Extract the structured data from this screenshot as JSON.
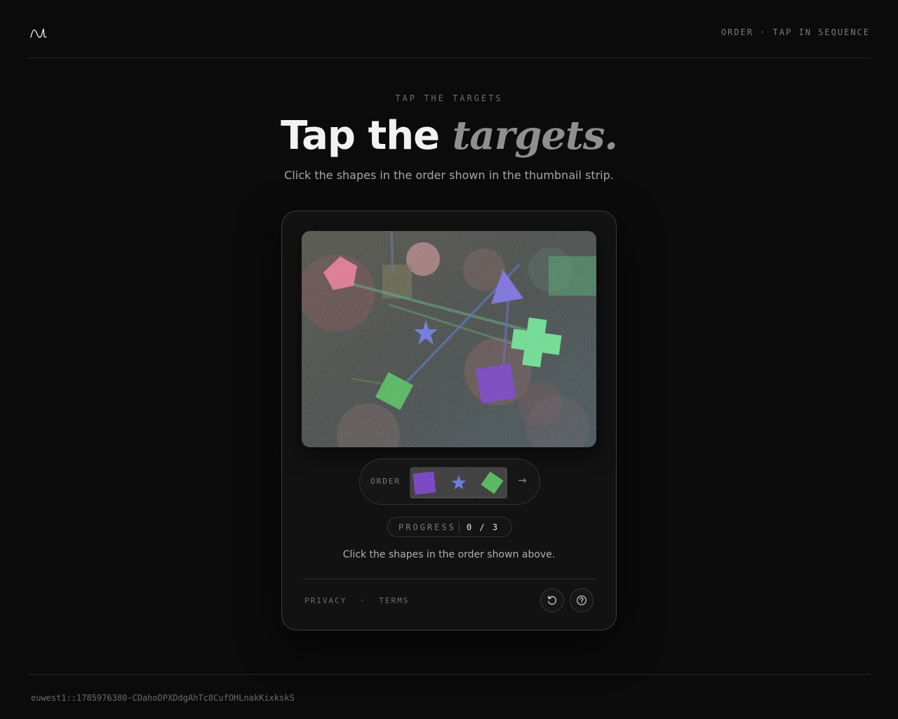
{
  "header": {
    "logo_icon": "wave-logo-icon",
    "mode_text": "ORDER · TAP IN SEQUENCE"
  },
  "hero": {
    "eyebrow": "TAP THE TARGETS",
    "title_plain": "Tap the",
    "title_emphasis": "targets.",
    "subtitle": "Click the shapes in the order shown in the thumbnail strip."
  },
  "challenge": {
    "order_label": "ORDER",
    "order_sequence": [
      "purple-square",
      "blue-star",
      "green-diamond"
    ],
    "next_icon": "arrow-right-icon",
    "next_glyph": "→",
    "progress_label": "PROGRESS",
    "progress_value": "0 / 3",
    "instruction": "Click the shapes in the order shown above.",
    "stage_shapes": [
      "pink-pentagon",
      "purple-triangle",
      "green-square",
      "blue-star",
      "green-cross",
      "purple-square",
      "green-diamond"
    ]
  },
  "card_footer": {
    "privacy_label": "PRIVACY",
    "separator": "·",
    "terms_label": "TERMS",
    "refresh_icon": "refresh-icon",
    "help_icon": "help-icon"
  },
  "footer": {
    "session_id": "euwest1::1785976380-CDahoDPXDdgAhTc8CufOHLnakKixkskS"
  },
  "colors": {
    "background": "#0b0b0b",
    "card": "#121212",
    "pink": "#e86a8c",
    "purple": "#6a2ac4",
    "blue": "#5a6ae8",
    "green": "#3fb84a",
    "mint": "#5ee88a"
  }
}
